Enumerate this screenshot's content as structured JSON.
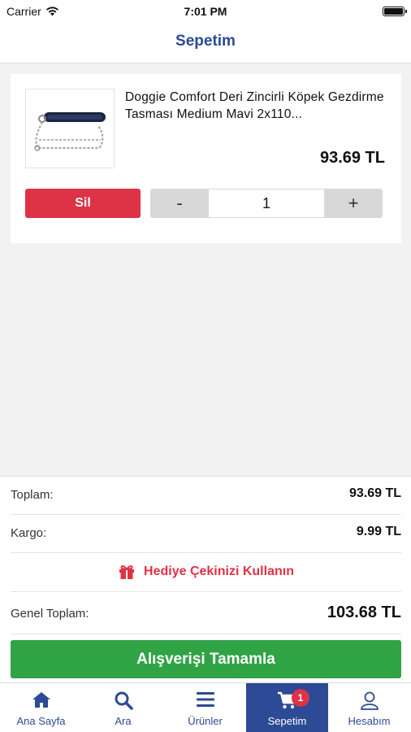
{
  "status_bar": {
    "carrier": "Carrier",
    "time": "7:01 PM"
  },
  "header": {
    "title": "Sepetim"
  },
  "cart_item": {
    "name": "Doggie Comfort Deri Zincirli Köpek Gezdirme Tasması Medium Mavi 2x110...",
    "price": "93.69 TL",
    "delete_label": "Sil",
    "qty_minus": "-",
    "qty_value": "1",
    "qty_plus": "+"
  },
  "summary": {
    "subtotal_label": "Toplam:",
    "subtotal_value": "93.69 TL",
    "shipping_label": "Kargo:",
    "shipping_value": "9.99 TL",
    "gift_label": "Hediye Çekinizi Kullanın",
    "grand_label": "Genel Toplam:",
    "grand_value": "103.68 TL",
    "checkout_label": "Alışverişi Tamamla"
  },
  "tabs": [
    {
      "label": "Ana Sayfa",
      "icon": "home-icon"
    },
    {
      "label": "Ara",
      "icon": "search-icon"
    },
    {
      "label": "Ürünler",
      "icon": "menu-icon"
    },
    {
      "label": "Sepetim",
      "icon": "cart-icon",
      "badge": "1",
      "active": true
    },
    {
      "label": "Hesabım",
      "icon": "user-icon"
    }
  ],
  "colors": {
    "brand_blue": "#2c4a95",
    "delete_red": "#de3246",
    "checkout_green": "#30a344"
  }
}
